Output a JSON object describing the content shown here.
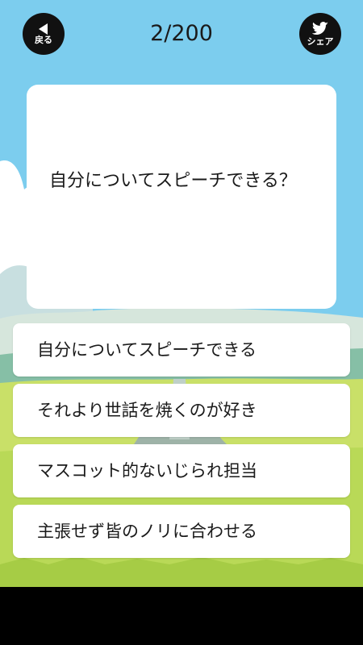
{
  "header": {
    "back_label": "戻る",
    "share_label": "シェア",
    "counter": "2/200"
  },
  "question": {
    "text": "自分についてスピーチできる？"
  },
  "answers": [
    {
      "label": "自分についてスピーチできる"
    },
    {
      "label": "それより世話を焼くのが好き"
    },
    {
      "label": "マスコット的ないじられ担当"
    },
    {
      "label": "主張せず皆のノリに合わせる"
    }
  ],
  "icons": {
    "back": "back-arrow-icon",
    "share": "twitter-bird-icon"
  },
  "colors": {
    "sky": "#7ccdee",
    "grass": "#c9e068",
    "button_dark": "#111111"
  }
}
